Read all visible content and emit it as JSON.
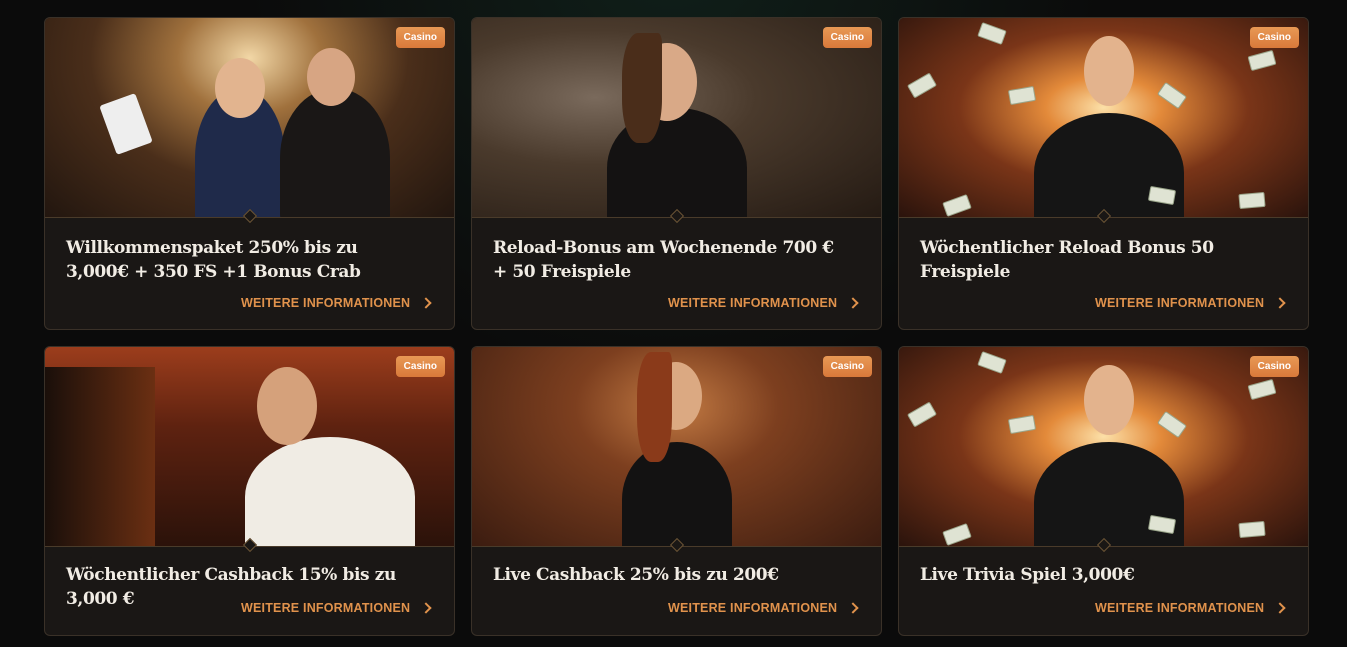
{
  "cards": [
    {
      "badge": "Casino",
      "title": "Willkommenspaket 250% bis zu 3,000€ + 350 FS +1 Bonus Crab",
      "link": "WEITERE INFORMATIONEN"
    },
    {
      "badge": "Casino",
      "title": "Reload-Bonus am Wochenende 700 € + 50 Freispiele",
      "link": "WEITERE INFORMATIONEN"
    },
    {
      "badge": "Casino",
      "title": "Wöchentlicher Reload Bonus 50 Freispiele",
      "link": "WEITERE INFORMATIONEN"
    },
    {
      "badge": "Casino",
      "title": "Wöchentlicher Cashback 15% bis zu 3,000 €",
      "link": "WEITERE INFORMATIONEN"
    },
    {
      "badge": "Casino",
      "title": "Live Cashback 25% bis zu 200€",
      "link": "WEITERE INFORMATIONEN"
    },
    {
      "badge": "Casino",
      "title": "Live Trivia Spiel 3,000€",
      "link": "WEITERE INFORMATIONEN"
    }
  ],
  "colors": {
    "accent": "#e0924c",
    "badge": "#d9793a",
    "card_bg": "#1a1715"
  },
  "icons": {
    "link_arrow": "chevron-right-icon"
  }
}
